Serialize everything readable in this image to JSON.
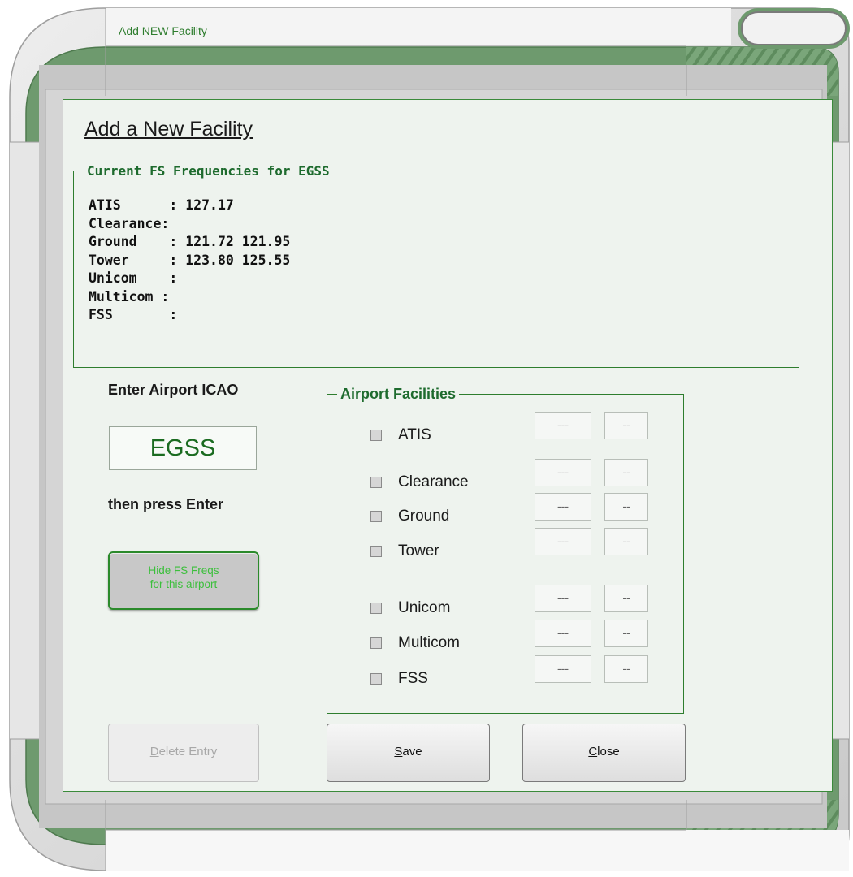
{
  "window": {
    "title": "Add NEW Facility"
  },
  "dialog": {
    "heading": "Add a New Facility",
    "frequencies": {
      "legend": "Current FS Frequencies for EGSS",
      "lines": [
        "ATIS      : 127.17",
        "Clearance:",
        "Ground    : 121.72 121.95",
        "Tower     : 123.80 125.55",
        "Unicom    :",
        "Multicom :",
        "FSS       :"
      ]
    },
    "icao": {
      "label": "Enter Airport ICAO",
      "value": "EGSS",
      "hint": "then press Enter"
    },
    "hide_button": {
      "line1": "Hide FS Freqs",
      "line2": "for this airport"
    },
    "facilities": {
      "legend": "Airport Facilities",
      "items": [
        {
          "label": "ATIS",
          "checked": false,
          "mhz": "---",
          "khz": "--"
        },
        {
          "label": "Clearance",
          "checked": false,
          "mhz": "---",
          "khz": "--"
        },
        {
          "label": "Ground",
          "checked": false,
          "mhz": "---",
          "khz": "--"
        },
        {
          "label": "Tower",
          "checked": false,
          "mhz": "---",
          "khz": "--"
        },
        {
          "label": "Unicom",
          "checked": false,
          "mhz": "---",
          "khz": "--"
        },
        {
          "label": "Multicom",
          "checked": false,
          "mhz": "---",
          "khz": "--"
        },
        {
          "label": "FSS",
          "checked": false,
          "mhz": "---",
          "khz": "--"
        }
      ]
    },
    "buttons": {
      "delete": {
        "accel": "D",
        "rest": "elete Entry",
        "enabled": false
      },
      "save": {
        "accel": "S",
        "rest": "ave"
      },
      "close": {
        "accel": "C",
        "rest": "lose"
      }
    }
  },
  "colors": {
    "accent_green": "#2e7d2e",
    "frame_green": "#6e9a6e",
    "panel_bg": "#eef3ee"
  }
}
